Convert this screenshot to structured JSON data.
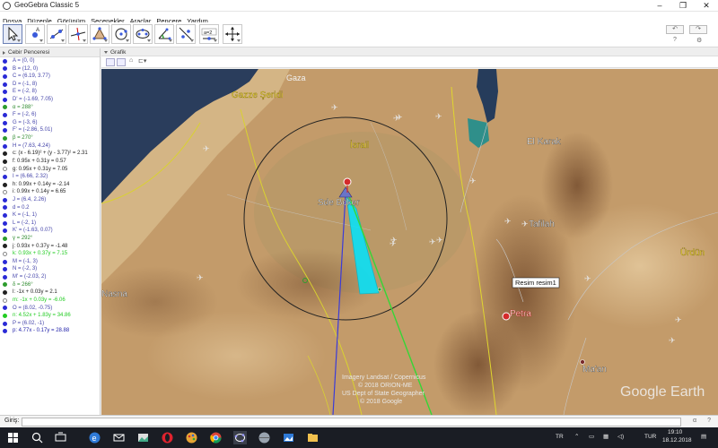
{
  "window": {
    "title": "GeoGebra Classic 5"
  },
  "menu": {
    "items": [
      "Dosya",
      "Düzenle",
      "Görünüm",
      "Seçenekler",
      "Araçlar",
      "Pencere",
      "Yardım"
    ]
  },
  "toolbar": {
    "tools": [
      "move-tool",
      "point-tool",
      "line-tool",
      "perpendicular-tool",
      "polygon-tool",
      "circle-tool",
      "conic-tool",
      "angle-tool",
      "reflect-tool",
      "slider-tool",
      "move-view-tool"
    ],
    "slider_text": "a=2"
  },
  "algebra": {
    "title": "Cebir Penceresi",
    "items": [
      {
        "text": "A = (0, 0)",
        "color": "#4444aa",
        "dot": "#2b2bd6"
      },
      {
        "text": "B = (12, 0)",
        "color": "#4444aa",
        "dot": "#2b2bd6"
      },
      {
        "text": "C = (6.19, 3.77)",
        "color": "#4444aa",
        "dot": "#2b2bd6"
      },
      {
        "text": "D = (-1, 8)",
        "color": "#4444aa",
        "dot": "#2b2bd6"
      },
      {
        "text": "E = (-2, 8)",
        "color": "#4444aa",
        "dot": "#2b2bd6"
      },
      {
        "text": "D' = (-1.69, 7.05)",
        "color": "#4444aa",
        "dot": "#2b2bd6"
      },
      {
        "text": "α = 288°",
        "color": "#2e8b2e",
        "dot": "#2e9c2e"
      },
      {
        "text": "F = (-2, 6)",
        "color": "#4444aa",
        "dot": "#2b2bd6"
      },
      {
        "text": "G = (-3, 6)",
        "color": "#4444aa",
        "dot": "#2b2bd6"
      },
      {
        "text": "F' = (-2.86, 5.01)",
        "color": "#4444aa",
        "dot": "#2b2bd6"
      },
      {
        "text": "β = 270°",
        "color": "#2e8b2e",
        "dot": "#2e9c2e"
      },
      {
        "text": "H = (7.63, 4.24)",
        "color": "#4444aa",
        "dot": "#2b2bd6"
      },
      {
        "text": "c: (x - 6.19)² + (y - 3.77)² = 2.31",
        "color": "#222222",
        "dot": "#222222"
      },
      {
        "text": "f: 0.95x + 0.31y = 0.57",
        "color": "#222222",
        "dot": "#222222"
      },
      {
        "text": "g: 0.95x + 0.31y = 7.05",
        "color": "#222222",
        "dot": "#ffffff"
      },
      {
        "text": "I = (6.66, 2.32)",
        "color": "#4444aa",
        "dot": "#2b2bd6"
      },
      {
        "text": "h: 0.99x + 0.14y = -2.14",
        "color": "#222222",
        "dot": "#222222"
      },
      {
        "text": "i: 0.99x + 0.14y = 6.65",
        "color": "#222222",
        "dot": "#ffffff"
      },
      {
        "text": "J = (6.4, 2.26)",
        "color": "#4444aa",
        "dot": "#2b2bd6"
      },
      {
        "text": "d = 0.2",
        "color": "#4444aa",
        "dot": "#2b2bd6"
      },
      {
        "text": "K = (-1, 1)",
        "color": "#4444aa",
        "dot": "#2b2bd6"
      },
      {
        "text": "L = (-2, 1)",
        "color": "#4444aa",
        "dot": "#2b2bd6"
      },
      {
        "text": "K' = (-1.63, 0.07)",
        "color": "#4444aa",
        "dot": "#2b2bd6"
      },
      {
        "text": "γ = 292°",
        "color": "#2e8b2e",
        "dot": "#2e9c2e"
      },
      {
        "text": "j: 0.93x + 0.37y = -1.48",
        "color": "#222222",
        "dot": "#222222"
      },
      {
        "text": "k: 0.93x + 0.37y = 7.15",
        "color": "#22cc22",
        "dot": "#ffffff"
      },
      {
        "text": "M = (-1, 3)",
        "color": "#4444aa",
        "dot": "#2b2bd6"
      },
      {
        "text": "N = (-2, 3)",
        "color": "#4444aa",
        "dot": "#2b2bd6"
      },
      {
        "text": "M' = (-2.03, 2)",
        "color": "#4444aa",
        "dot": "#2b2bd6"
      },
      {
        "text": "δ = 266°",
        "color": "#2e8b2e",
        "dot": "#2e9c2e"
      },
      {
        "text": "l: -1x + 0.03y = 2.1",
        "color": "#222222",
        "dot": "#222222"
      },
      {
        "text": "m: -1x + 0.03y = -6.06",
        "color": "#22cc22",
        "dot": "#ffffff"
      },
      {
        "text": "O = (8.02, -0.75)",
        "color": "#4444aa",
        "dot": "#2b2bd6"
      },
      {
        "text": "n: 4.52x + 1.83y = 34.86",
        "color": "#22cc22",
        "dot": "#22cc22"
      },
      {
        "text": "P = (6.02, -1)",
        "color": "#4444aa",
        "dot": "#2b2bd6"
      },
      {
        "text": "p: 4.77x - 0.17y = 28.88",
        "color": "#2222aa",
        "dot": "#2b2bd6"
      }
    ]
  },
  "graphics": {
    "title": "Grafik",
    "labels": {
      "gazze": "Gazze Şeridi",
      "israil": "İsrail",
      "sde_boker": "Sde Boker",
      "el_karak": "El Karak",
      "tafilah": "Tafilah",
      "urdun": "Ürdün",
      "petra": "Petra",
      "maan": "Ma'an",
      "nasna": "Nasna",
      "resim": "Resim resim1",
      "attrib1": "Imagery Landsat / Copernicus",
      "attrib2": "© 2018 ORION-ME",
      "attrib3": "US Dept of State Geographer",
      "attrib4": "© 2018 Google",
      "google": "Google Earth",
      "gaza_top": "Gaza"
    }
  },
  "input": {
    "label": "Giriş:",
    "value": "",
    "alpha": "α",
    "help": "?"
  },
  "taskbar": {
    "lang": "TR",
    "kbd": "TUR",
    "time": "19:10",
    "date": "18.12.2018"
  }
}
